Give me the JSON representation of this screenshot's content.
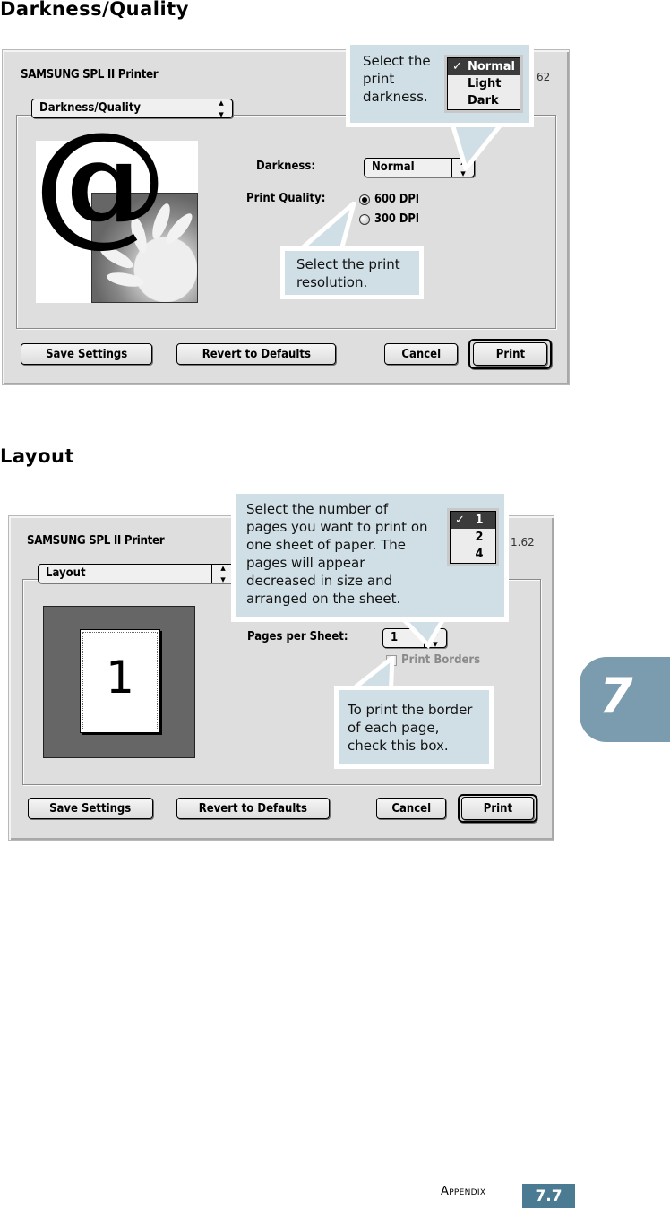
{
  "sections": {
    "darkness_quality": {
      "heading": "Darkness/Quality",
      "dialog": {
        "title": "SAMSUNG SPL II Printer",
        "version": "62",
        "panel_popup": "Darkness/Quality",
        "darkness_label": "Darkness:",
        "darkness_value": "Normal",
        "print_quality_label": "Print Quality:",
        "quality_options": [
          {
            "label": "600 DPI",
            "selected": true
          },
          {
            "label": "300 DPI",
            "selected": false
          }
        ],
        "buttons": {
          "save": "Save Settings",
          "revert": "Revert to Defaults",
          "cancel": "Cancel",
          "print": "Print"
        }
      },
      "callouts": {
        "darkness": {
          "text": "Select the\nprint\ndarkness.",
          "menu": [
            {
              "label": "Normal",
              "checked": true
            },
            {
              "label": "Light",
              "checked": false
            },
            {
              "label": "Dark",
              "checked": false
            }
          ]
        },
        "resolution": {
          "text": "Select the print\nresolution."
        }
      }
    },
    "layout": {
      "heading": "Layout",
      "dialog": {
        "title": "SAMSUNG SPL II Printer",
        "version": "1.62",
        "panel_popup": "Layout",
        "preview_page_number": "1",
        "pages_per_sheet_label": "Pages per Sheet:",
        "pages_per_sheet_value": "1",
        "print_borders_label": "Print Borders",
        "print_borders_checked": false,
        "buttons": {
          "save": "Save Settings",
          "revert": "Revert to Defaults",
          "cancel": "Cancel",
          "print": "Print"
        }
      },
      "callouts": {
        "pages": {
          "text": "Select the number of\npages you want to print on\none sheet of paper. The\npages will appear\ndecreased in size and\narranged on the sheet.",
          "menu": [
            {
              "label": "1",
              "checked": true
            },
            {
              "label": "2",
              "checked": false
            },
            {
              "label": "4",
              "checked": false
            }
          ]
        },
        "borders": {
          "text": "To print the border\nof each page,\ncheck this box."
        }
      }
    }
  },
  "chapter_tab": "7",
  "footer": {
    "label": "Appendix",
    "page": "7.7"
  },
  "colors": {
    "callout_bg": "#d0dfe6",
    "tab_bg": "#7b9cae",
    "footer_page_bg": "#4b7a93",
    "dialog_bg": "#dedede"
  }
}
